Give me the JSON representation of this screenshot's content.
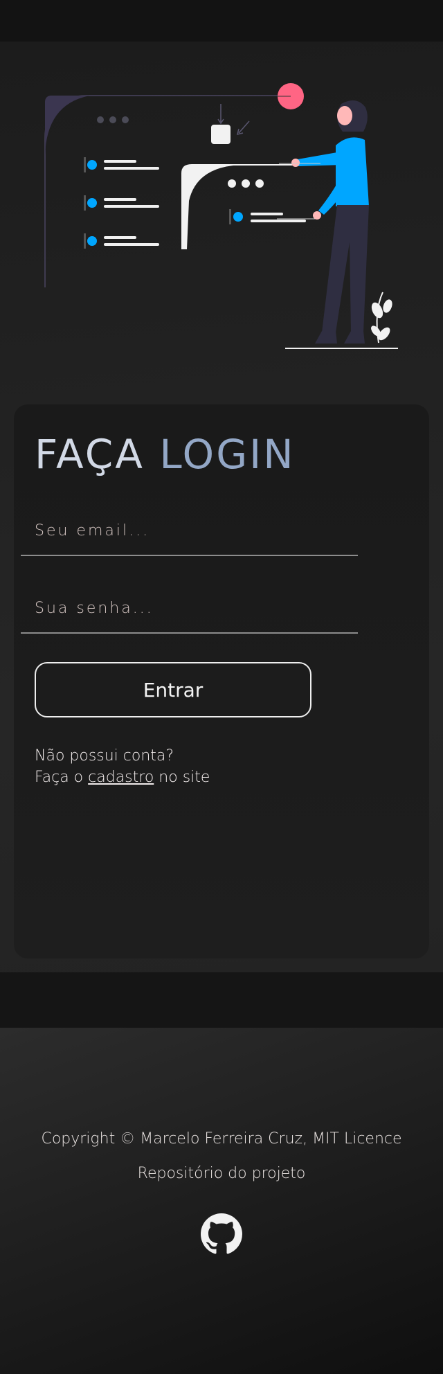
{
  "login": {
    "title_part1": "FAÇA",
    "title_part2": "LOGIN",
    "email_placeholder": "Seu email...",
    "password_placeholder": "Sua senha...",
    "submit_label": "Entrar",
    "no_account_text": "Não possui conta?",
    "signup_prefix": "Faça o",
    "signup_link": "cadastro",
    "signup_suffix": "no site"
  },
  "footer": {
    "copyright": "Copyright © Marcelo Ferreira Cruz, MIT Licence",
    "repo_label": "Repositório do projeto",
    "repo_icon": "github-icon"
  },
  "colors": {
    "accent_blue": "#00a6ff",
    "accent_pink": "#ff6584",
    "title_light": "#d2d9e6",
    "title_blue": "#93a7c6"
  }
}
